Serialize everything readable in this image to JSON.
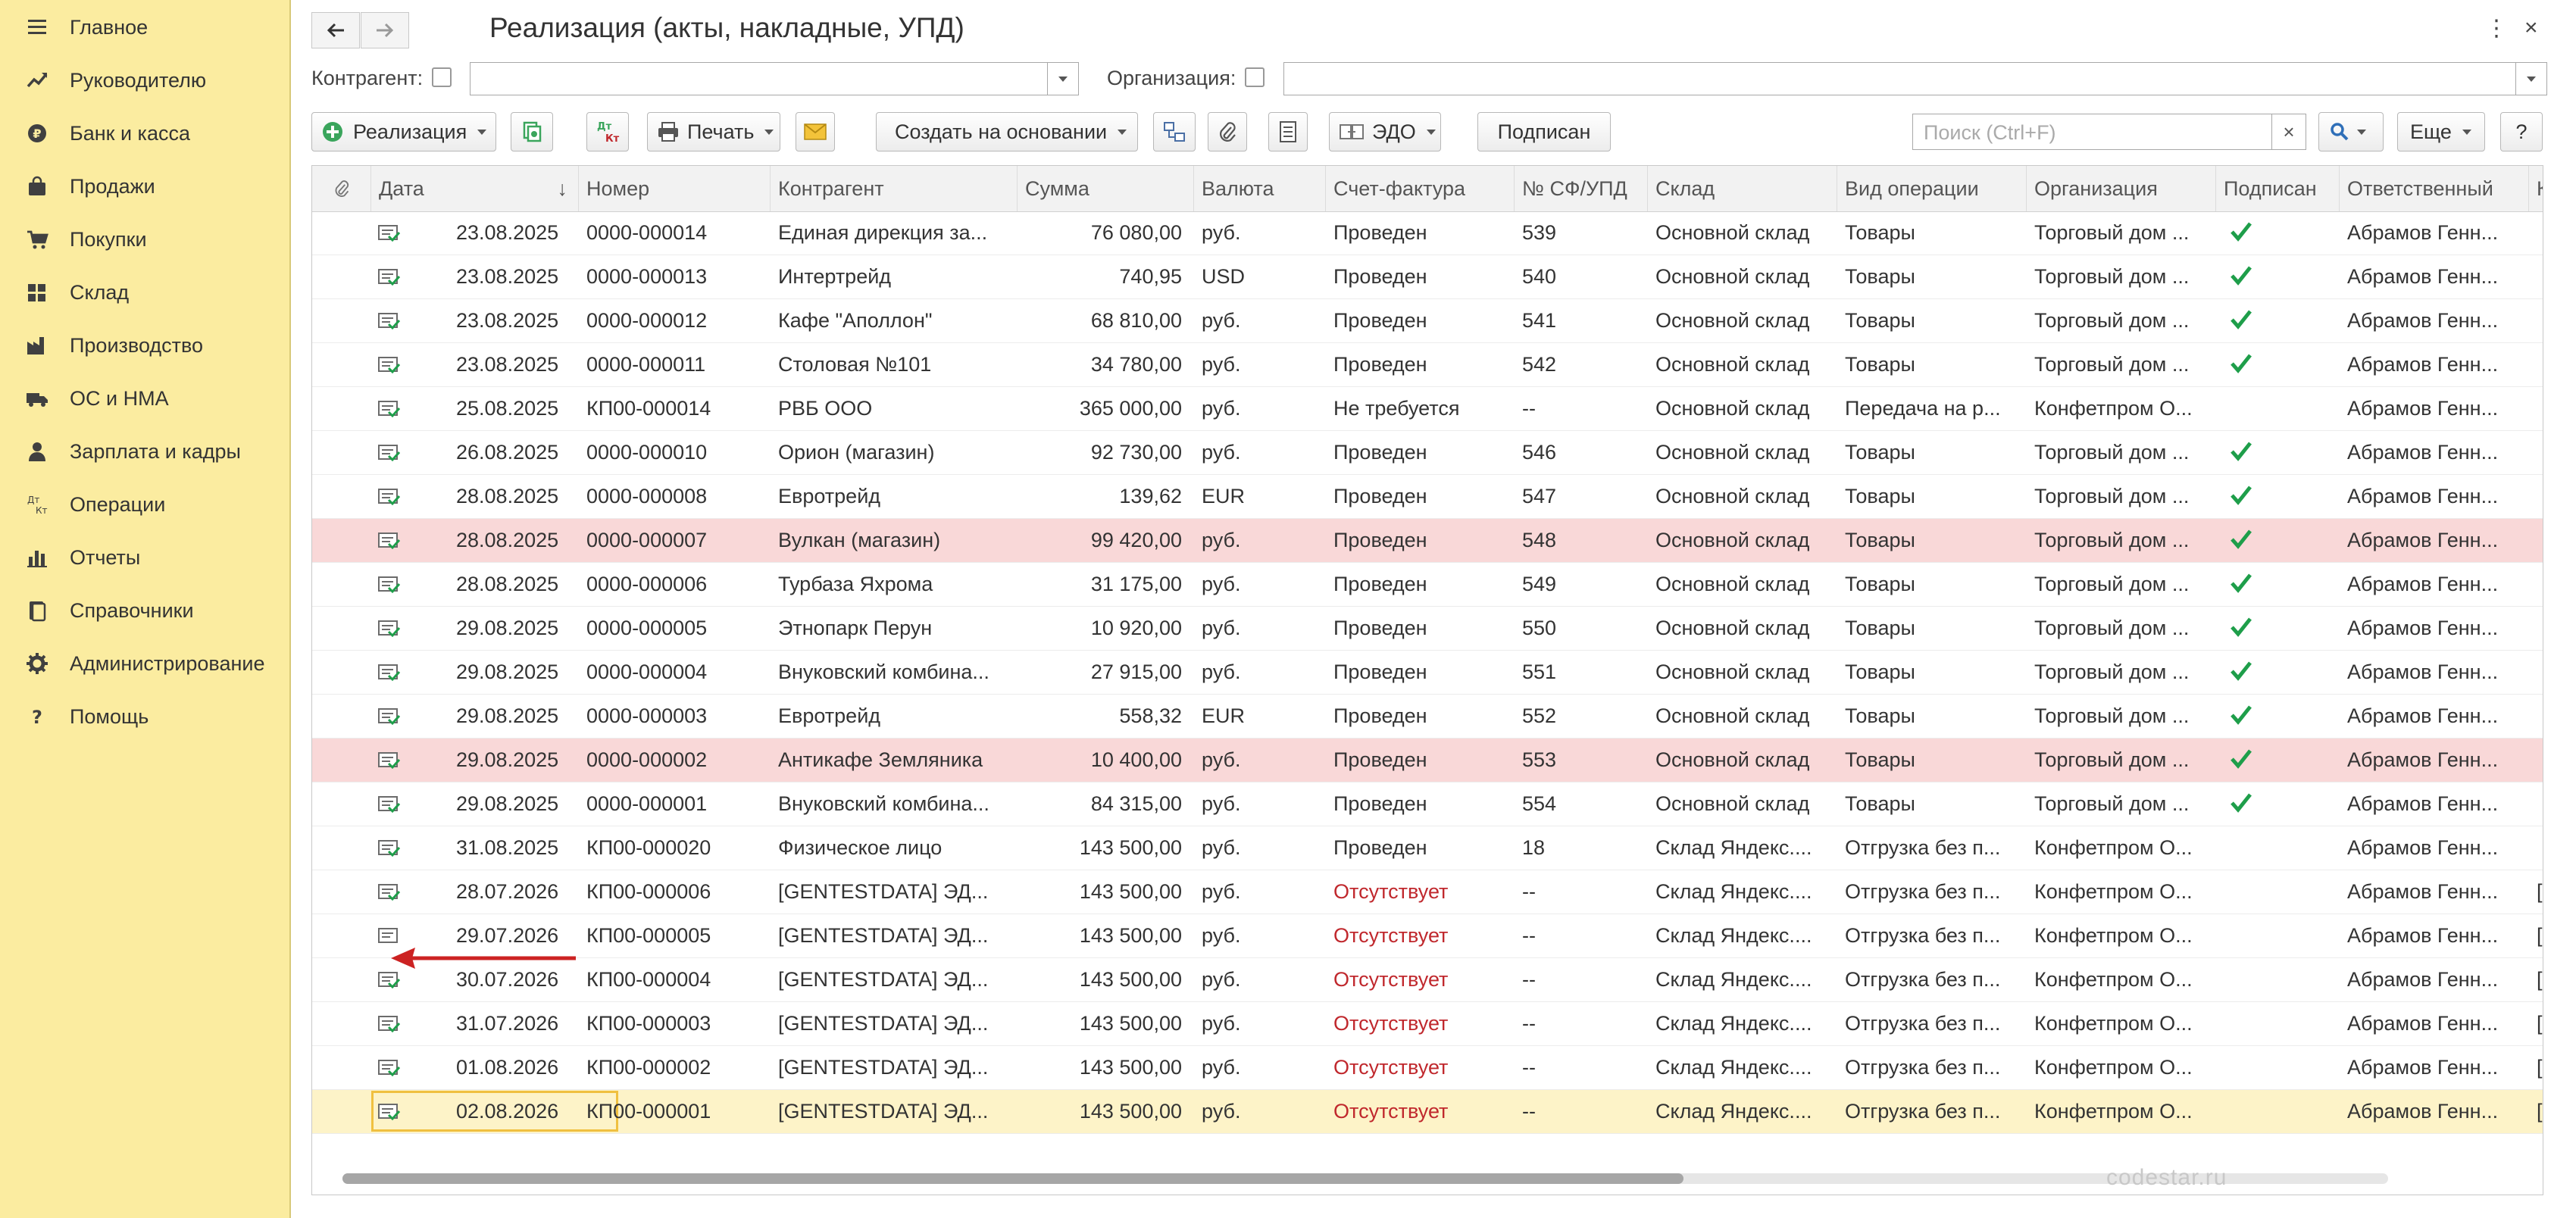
{
  "sidebar": {
    "items": [
      {
        "label": "Главное",
        "icon": "menu-icon"
      },
      {
        "label": "Руководителю",
        "icon": "trend-icon"
      },
      {
        "label": "Банк и касса",
        "icon": "coin-icon"
      },
      {
        "label": "Продажи",
        "icon": "bag-icon"
      },
      {
        "label": "Покупки",
        "icon": "cart-icon"
      },
      {
        "label": "Склад",
        "icon": "warehouse-icon"
      },
      {
        "label": "Производство",
        "icon": "factory-icon"
      },
      {
        "label": "ОС и НМА",
        "icon": "truck-icon"
      },
      {
        "label": "Зарплата и кадры",
        "icon": "person-icon"
      },
      {
        "label": "Операции",
        "icon": "dt-kt-icon"
      },
      {
        "label": "Отчеты",
        "icon": "bar-chart-icon"
      },
      {
        "label": "Справочники",
        "icon": "books-icon"
      },
      {
        "label": "Администрирование",
        "icon": "gear-icon"
      },
      {
        "label": "Помощь",
        "icon": "question-icon"
      }
    ]
  },
  "window": {
    "title": "Реализация (акты, накладные, УПД)",
    "more_glyph": "⋮",
    "close_glyph": "×"
  },
  "filters": {
    "counterparty_label": "Контрагент:",
    "counterparty_value": "",
    "organization_label": "Организация:",
    "organization_value": ""
  },
  "toolbar": {
    "realization_label": "Реализация",
    "dtkt_label_top": "Дт",
    "dtkt_label_bottom": "Кт",
    "print_label": "Печать",
    "create_basis_label": "Создать на основании",
    "edo_label": "ЭДО",
    "signed_label": "Подписан",
    "search_placeholder": "Поиск (Ctrl+F)",
    "search_clear": "×",
    "more_label": "Еще",
    "help_label": "?"
  },
  "table": {
    "columns": [
      "Дата",
      "Номер",
      "Контрагент",
      "Сумма",
      "Валюта",
      "Счет-фактура",
      "№ СФ/УПД",
      "Склад",
      "Вид операции",
      "Организация",
      "Подписан",
      "Ответственный",
      "Ко"
    ],
    "sort_glyph": "↓",
    "rows": [
      {
        "date": "23.08.2025",
        "number": "0000-000014",
        "counterparty": "Единая дирекция за...",
        "sum": "76 080,00",
        "currency": "руб.",
        "invoice": "Проведен",
        "sf_no": "539",
        "warehouse": "Основной склад",
        "operation": "Товары",
        "org": "Торговый дом ...",
        "signed": true,
        "responsible": "Абрамов Генн...",
        "extra": "",
        "highlight": false,
        "invoice_missing": false
      },
      {
        "date": "23.08.2025",
        "number": "0000-000013",
        "counterparty": "Интертрейд",
        "sum": "740,95",
        "currency": "USD",
        "invoice": "Проведен",
        "sf_no": "540",
        "warehouse": "Основной склад",
        "operation": "Товары",
        "org": "Торговый дом ...",
        "signed": true,
        "responsible": "Абрамов Генн...",
        "extra": "",
        "highlight": false,
        "invoice_missing": false
      },
      {
        "date": "23.08.2025",
        "number": "0000-000012",
        "counterparty": "Кафе \"Аполлон\"",
        "sum": "68 810,00",
        "currency": "руб.",
        "invoice": "Проведен",
        "sf_no": "541",
        "warehouse": "Основной склад",
        "operation": "Товары",
        "org": "Торговый дом ...",
        "signed": true,
        "responsible": "Абрамов Генн...",
        "extra": "",
        "highlight": false,
        "invoice_missing": false
      },
      {
        "date": "23.08.2025",
        "number": "0000-000011",
        "counterparty": "Столовая №101",
        "sum": "34 780,00",
        "currency": "руб.",
        "invoice": "Проведен",
        "sf_no": "542",
        "warehouse": "Основной склад",
        "operation": "Товары",
        "org": "Торговый дом ...",
        "signed": true,
        "responsible": "Абрамов Генн...",
        "extra": "",
        "highlight": false,
        "invoice_missing": false
      },
      {
        "date": "25.08.2025",
        "number": "КП00-000014",
        "counterparty": "РВБ ООО",
        "sum": "365 000,00",
        "currency": "руб.",
        "invoice": "Не требуется",
        "sf_no": "--",
        "warehouse": "Основной склад",
        "operation": "Передача на р...",
        "org": "Конфетпром О...",
        "signed": false,
        "responsible": "Абрамов Генн...",
        "extra": "",
        "highlight": false,
        "invoice_missing": false
      },
      {
        "date": "26.08.2025",
        "number": "0000-000010",
        "counterparty": "Орион (магазин)",
        "sum": "92 730,00",
        "currency": "руб.",
        "invoice": "Проведен",
        "sf_no": "546",
        "warehouse": "Основной склад",
        "operation": "Товары",
        "org": "Торговый дом ...",
        "signed": true,
        "responsible": "Абрамов Генн...",
        "extra": "",
        "highlight": false,
        "invoice_missing": false
      },
      {
        "date": "28.08.2025",
        "number": "0000-000008",
        "counterparty": "Евротрейд",
        "sum": "139,62",
        "currency": "EUR",
        "invoice": "Проведен",
        "sf_no": "547",
        "warehouse": "Основной склад",
        "operation": "Товары",
        "org": "Торговый дом ...",
        "signed": true,
        "responsible": "Абрамов Генн...",
        "extra": "",
        "highlight": false,
        "invoice_missing": false
      },
      {
        "date": "28.08.2025",
        "number": "0000-000007",
        "counterparty": "Вулкан (магазин)",
        "sum": "99 420,00",
        "currency": "руб.",
        "invoice": "Проведен",
        "sf_no": "548",
        "warehouse": "Основной склад",
        "operation": "Товары",
        "org": "Торговый дом ...",
        "signed": true,
        "responsible": "Абрамов Генн...",
        "extra": "",
        "highlight": true,
        "invoice_missing": false
      },
      {
        "date": "28.08.2025",
        "number": "0000-000006",
        "counterparty": "Турбаза Яхрома",
        "sum": "31 175,00",
        "currency": "руб.",
        "invoice": "Проведен",
        "sf_no": "549",
        "warehouse": "Основной склад",
        "operation": "Товары",
        "org": "Торговый дом ...",
        "signed": true,
        "responsible": "Абрамов Генн...",
        "extra": "",
        "highlight": false,
        "invoice_missing": false
      },
      {
        "date": "29.08.2025",
        "number": "0000-000005",
        "counterparty": "Этнопарк Перун",
        "sum": "10 920,00",
        "currency": "руб.",
        "invoice": "Проведен",
        "sf_no": "550",
        "warehouse": "Основной склад",
        "operation": "Товары",
        "org": "Торговый дом ...",
        "signed": true,
        "responsible": "Абрамов Генн...",
        "extra": "",
        "highlight": false,
        "invoice_missing": false
      },
      {
        "date": "29.08.2025",
        "number": "0000-000004",
        "counterparty": "Внуковский комбина...",
        "sum": "27 915,00",
        "currency": "руб.",
        "invoice": "Проведен",
        "sf_no": "551",
        "warehouse": "Основной склад",
        "operation": "Товары",
        "org": "Торговый дом ...",
        "signed": true,
        "responsible": "Абрамов Генн...",
        "extra": "",
        "highlight": false,
        "invoice_missing": false
      },
      {
        "date": "29.08.2025",
        "number": "0000-000003",
        "counterparty": "Евротрейд",
        "sum": "558,32",
        "currency": "EUR",
        "invoice": "Проведен",
        "sf_no": "552",
        "warehouse": "Основной склад",
        "operation": "Товары",
        "org": "Торговый дом ...",
        "signed": true,
        "responsible": "Абрамов Генн...",
        "extra": "",
        "highlight": false,
        "invoice_missing": false
      },
      {
        "date": "29.08.2025",
        "number": "0000-000002",
        "counterparty": "Антикафе Земляника",
        "sum": "10 400,00",
        "currency": "руб.",
        "invoice": "Проведен",
        "sf_no": "553",
        "warehouse": "Основной склад",
        "operation": "Товары",
        "org": "Торговый дом ...",
        "signed": true,
        "responsible": "Абрамов Генн...",
        "extra": "",
        "highlight": true,
        "invoice_missing": false
      },
      {
        "date": "29.08.2025",
        "number": "0000-000001",
        "counterparty": "Внуковский комбина...",
        "sum": "84 315,00",
        "currency": "руб.",
        "invoice": "Проведен",
        "sf_no": "554",
        "warehouse": "Основной склад",
        "operation": "Товары",
        "org": "Торговый дом ...",
        "signed": true,
        "responsible": "Абрамов Генн...",
        "extra": "",
        "highlight": false,
        "invoice_missing": false
      },
      {
        "date": "31.08.2025",
        "number": "КП00-000020",
        "counterparty": "Физическое лицо",
        "sum": "143 500,00",
        "currency": "руб.",
        "invoice": "Проведен",
        "sf_no": "18",
        "warehouse": "Склад Яндекс....",
        "operation": "Отгрузка без п...",
        "org": "Конфетпром О...",
        "signed": false,
        "responsible": "Абрамов Генн...",
        "extra": "",
        "highlight": false,
        "invoice_missing": false
      },
      {
        "date": "28.07.2026",
        "number": "КП00-000006",
        "counterparty": "[GENTESTDATA] ЭД...",
        "sum": "143 500,00",
        "currency": "руб.",
        "invoice": "Отсутствует",
        "sf_no": "--",
        "warehouse": "Склад Яндекс....",
        "operation": "Отгрузка без п...",
        "org": "Конфетпром О...",
        "signed": false,
        "responsible": "Абрамов Генн...",
        "extra": "[G",
        "highlight": false,
        "invoice_missing": true
      },
      {
        "date": "29.07.2026",
        "number": "КП00-000005",
        "counterparty": "[GENTESTDATA] ЭД...",
        "sum": "143 500,00",
        "currency": "руб.",
        "invoice": "Отсутствует",
        "sf_no": "--",
        "warehouse": "Склад Яндекс....",
        "operation": "Отгрузка без п...",
        "org": "Конфетпром О...",
        "signed": false,
        "responsible": "Абрамов Генн...",
        "extra": "[G",
        "highlight": false,
        "invoice_missing": true
      },
      {
        "date": "30.07.2026",
        "number": "КП00-000004",
        "counterparty": "[GENTESTDATA] ЭД...",
        "sum": "143 500,00",
        "currency": "руб.",
        "invoice": "Отсутствует",
        "sf_no": "--",
        "warehouse": "Склад Яндекс....",
        "operation": "Отгрузка без п...",
        "org": "Конфетпром О...",
        "signed": false,
        "responsible": "Абрамов Генн...",
        "extra": "[G",
        "highlight": false,
        "invoice_missing": true
      },
      {
        "date": "31.07.2026",
        "number": "КП00-000003",
        "counterparty": "[GENTESTDATA] ЭД...",
        "sum": "143 500,00",
        "currency": "руб.",
        "invoice": "Отсутствует",
        "sf_no": "--",
        "warehouse": "Склад Яндекс....",
        "operation": "Отгрузка без п...",
        "org": "Конфетпром О...",
        "signed": false,
        "responsible": "Абрамов Генн...",
        "extra": "[G",
        "highlight": false,
        "invoice_missing": true
      },
      {
        "date": "01.08.2026",
        "number": "КП00-000002",
        "counterparty": "[GENTESTDATA] ЭД...",
        "sum": "143 500,00",
        "currency": "руб.",
        "invoice": "Отсутствует",
        "sf_no": "--",
        "warehouse": "Склад Яндекс....",
        "operation": "Отгрузка без п...",
        "org": "Конфетпром О...",
        "signed": false,
        "responsible": "Абрамов Генн...",
        "extra": "[G",
        "highlight": false,
        "invoice_missing": true
      },
      {
        "date": "02.08.2026",
        "number": "КП00-000001",
        "counterparty": "[GENTESTDATA] ЭД...",
        "sum": "143 500,00",
        "currency": "руб.",
        "invoice": "Отсутствует",
        "sf_no": "--",
        "warehouse": "Склад Яндекс....",
        "operation": "Отгрузка без п...",
        "org": "Конфетпром О...",
        "signed": false,
        "responsible": "Абрамов Генн...",
        "extra": "[G",
        "highlight": false,
        "invoice_missing": true,
        "selected": true
      }
    ]
  },
  "watermark": "codestar.ru",
  "colors": {
    "sidebar_bg": "#fbeca0",
    "row_highlight": "#f9d8d8",
    "row_selected": "#fdf3c8",
    "missing_text": "#c0282d",
    "check_green": "#1e9e4a",
    "annotation_arrow": "#cc2222"
  }
}
